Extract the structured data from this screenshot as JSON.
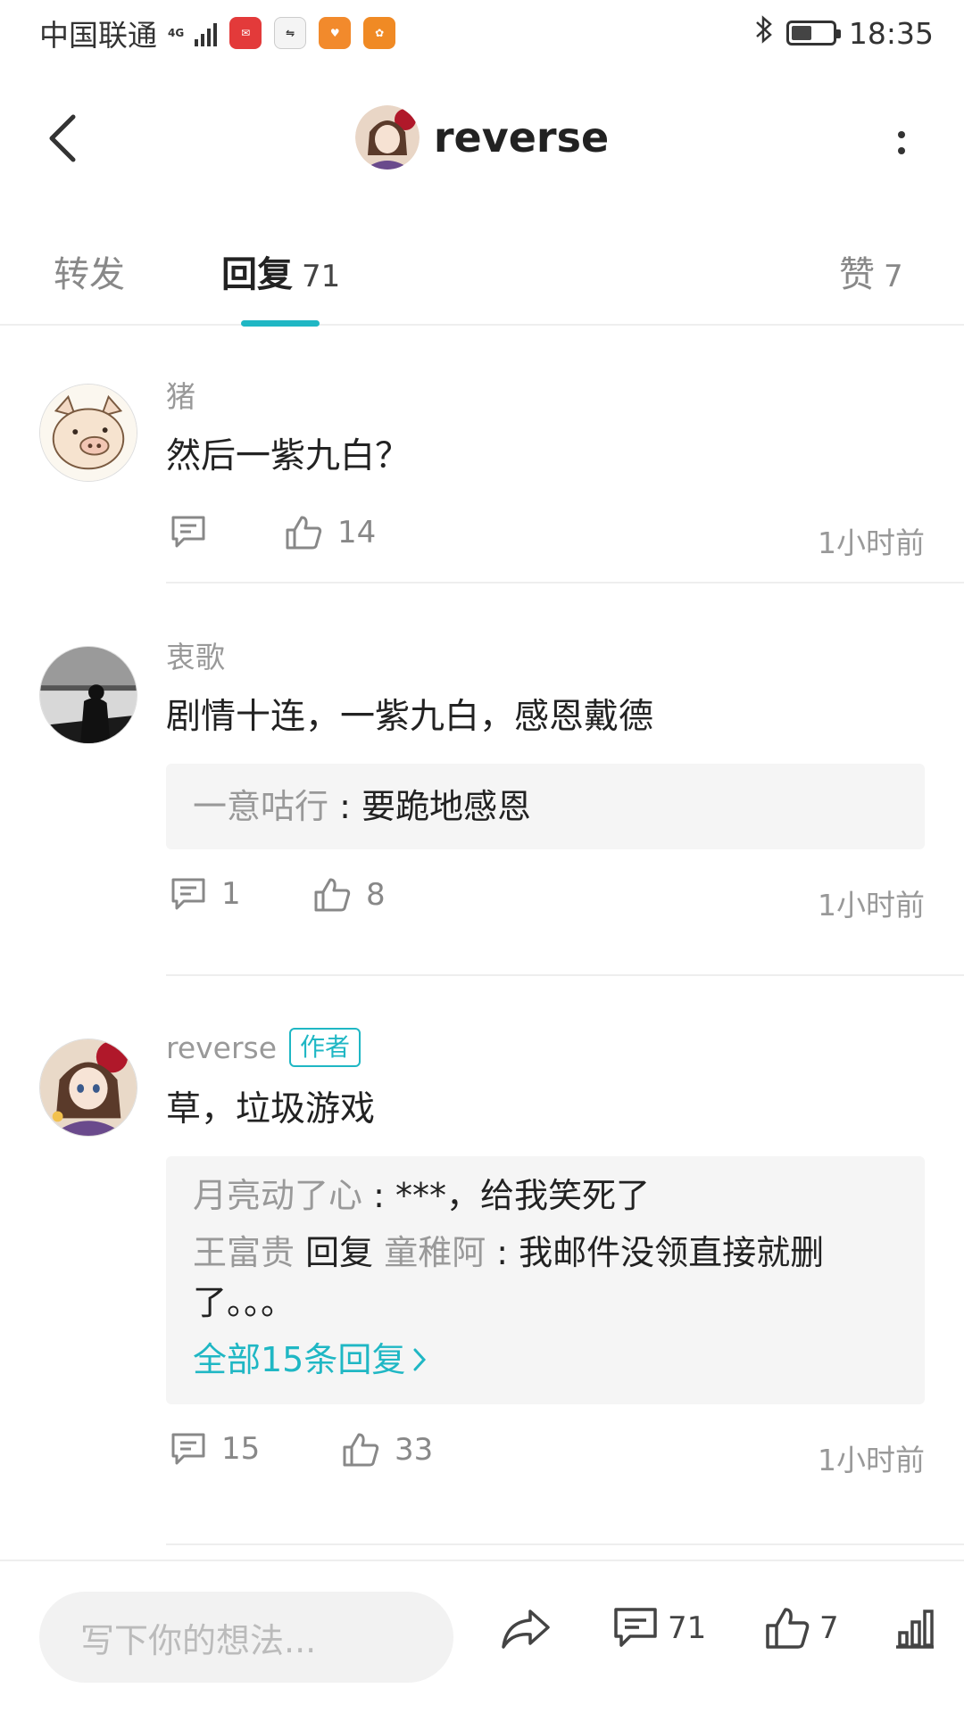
{
  "status_bar": {
    "carrier": "中国联通",
    "network": "4G",
    "time": "18:35",
    "battery_level": 0.5,
    "apps": [
      "huawei-app",
      "link-app",
      "heart-app",
      "squirrel-app"
    ]
  },
  "header": {
    "title": "reverse"
  },
  "tabs": [
    {
      "label": "转发",
      "count": ""
    },
    {
      "label": "回复",
      "count": "71"
    },
    {
      "label": "赞",
      "count": "7"
    }
  ],
  "comments": [
    {
      "name": "猪",
      "text": "然后一紫九白？",
      "comment_count": "",
      "like_count": "14",
      "time": "1小时前"
    },
    {
      "name": "衷歌",
      "text": "剧情十连，一紫九白，感恩戴德",
      "reply": {
        "name": "一意咕行",
        "sep": " : ",
        "text": "要跪地感恩"
      },
      "comment_count": "1",
      "like_count": "8",
      "time": "1小时前"
    },
    {
      "name": "reverse",
      "badge": "作者",
      "text": "草，垃圾游戏",
      "replies": [
        {
          "name": "月亮动了心",
          "sep": " : ",
          "text": "***，给我笑死了"
        },
        {
          "name": "王富贵",
          "reply_word": " 回复 ",
          "target": "童稚阿",
          "sep": " : ",
          "text": "我邮件没领直接就删了。。。"
        }
      ],
      "all_replies_link": "全部15条回复",
      "comment_count": "15",
      "like_count": "33",
      "time": "1小时前"
    }
  ],
  "bottom_bar": {
    "placeholder": "写下你的想法...",
    "comment_count": "71",
    "like_count": "7"
  },
  "colors": {
    "accent": "#1fb7c4",
    "text": "#222222",
    "muted": "#999999"
  }
}
